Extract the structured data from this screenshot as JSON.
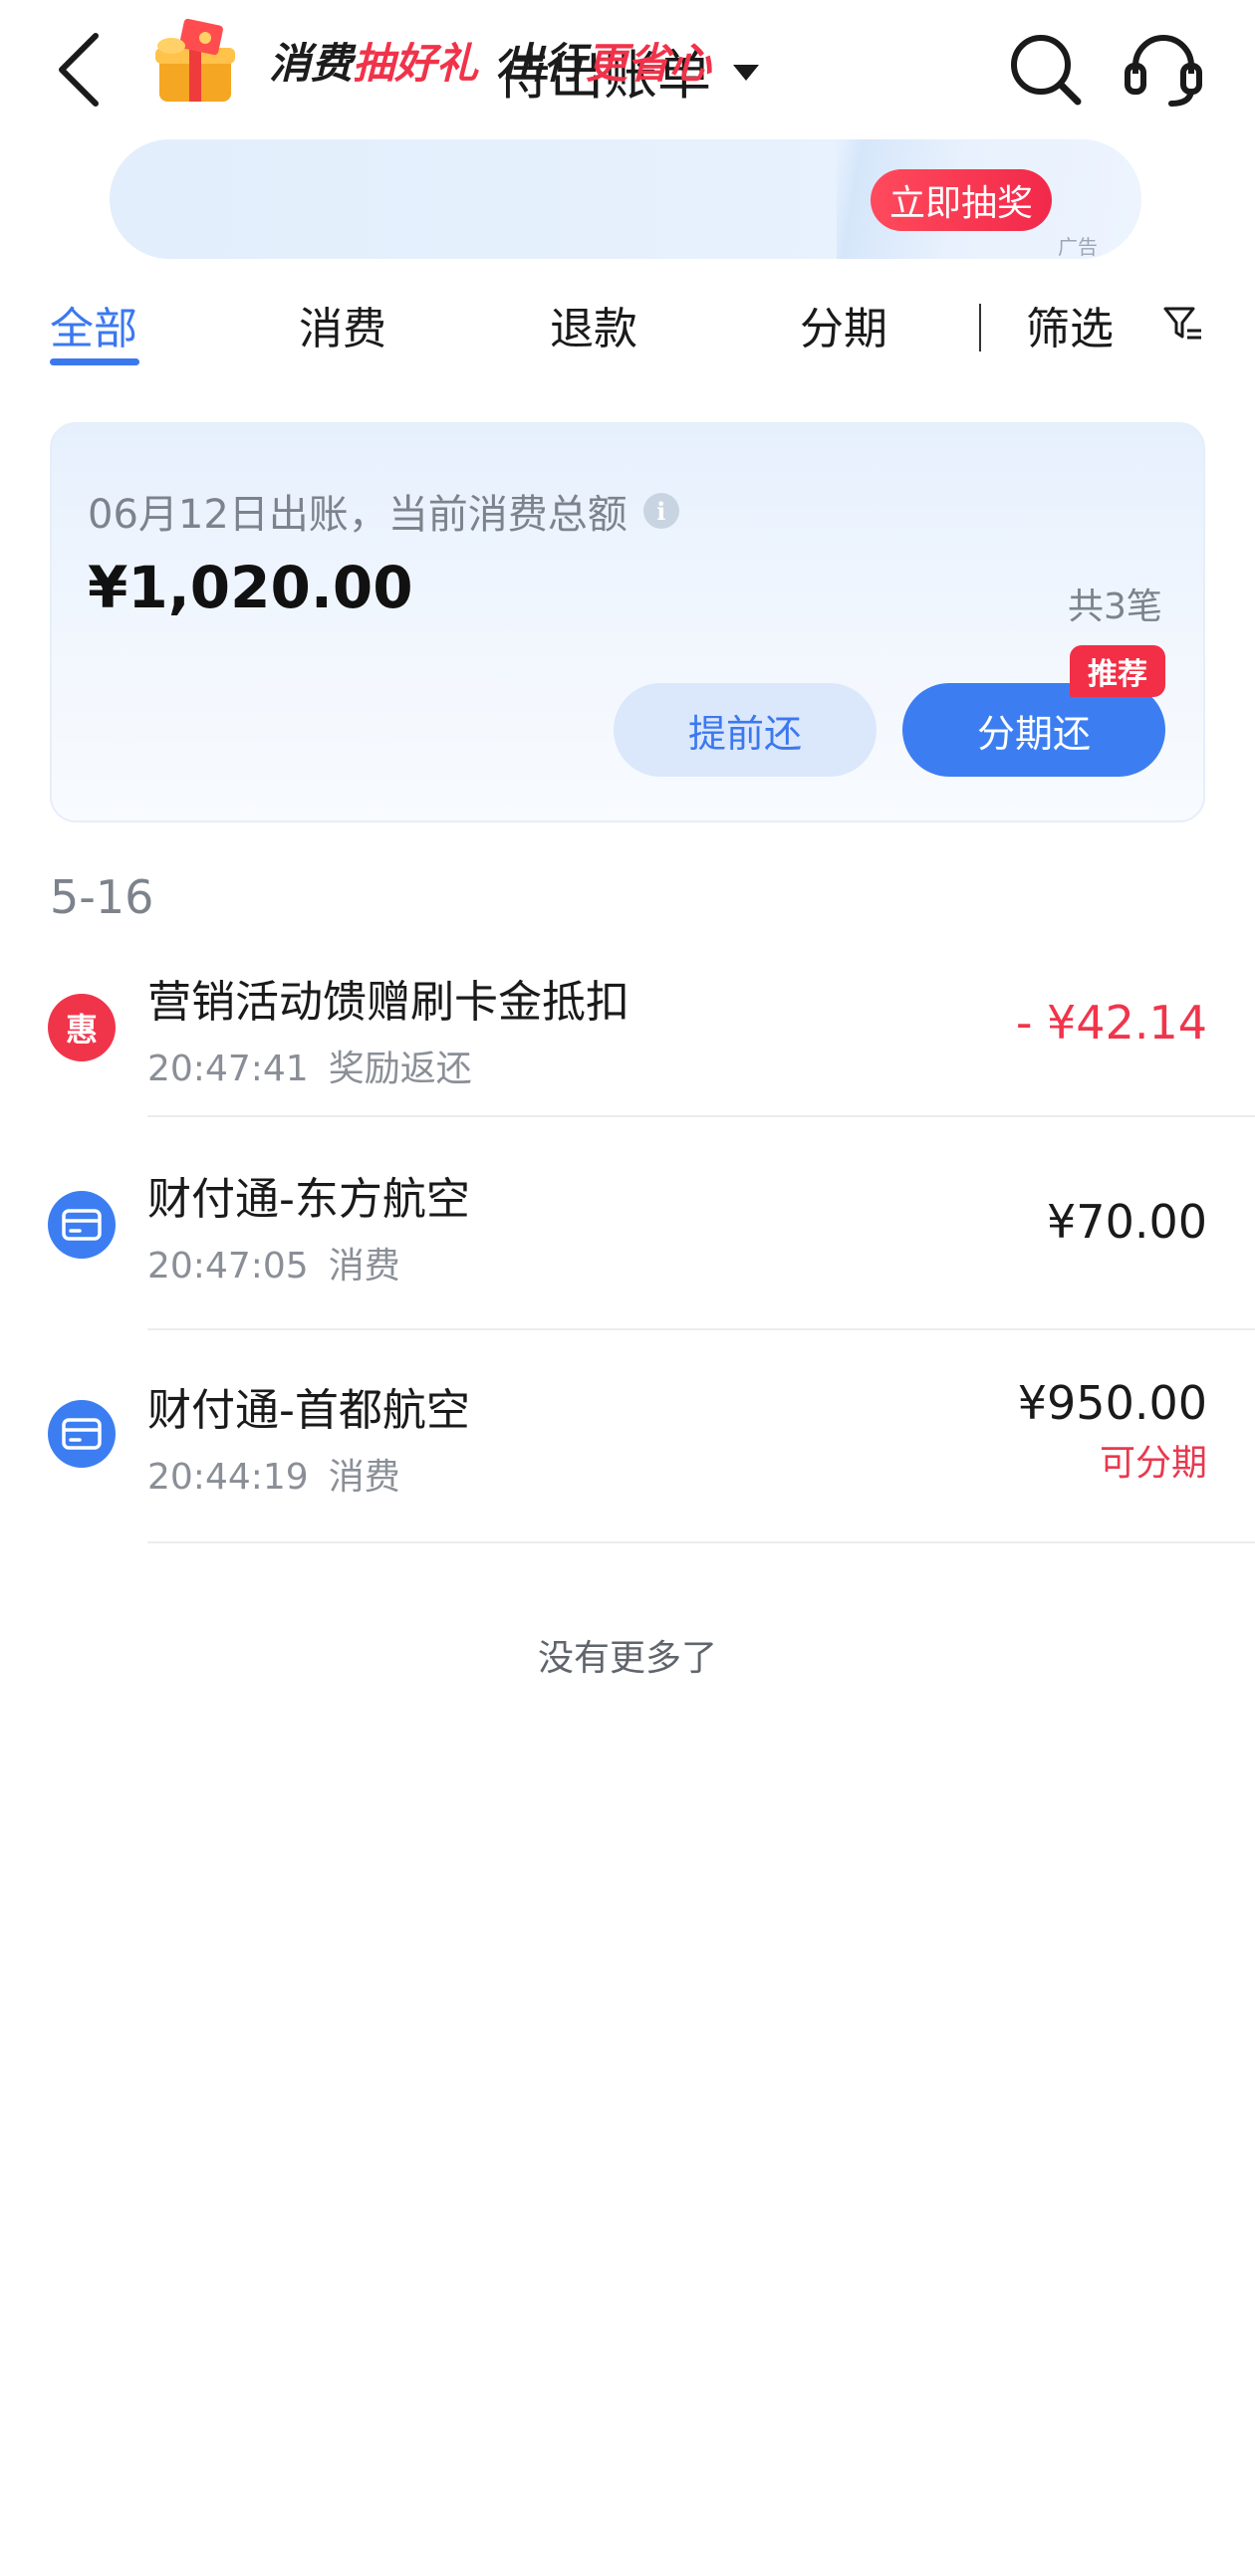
{
  "header": {
    "title": "待出账单",
    "icons": {
      "back": "back-arrow-icon",
      "dropdown": "caret-down-icon",
      "search": "search-icon",
      "service": "headset-icon"
    }
  },
  "banner": {
    "text_parts": [
      "消费",
      "抽好礼",
      "出行",
      "更省心"
    ],
    "button": "立即抽奖",
    "ad_label": "广告",
    "icon": "gift-box-icon"
  },
  "tabs": [
    {
      "label": "全部",
      "active": true
    },
    {
      "label": "消费",
      "active": false
    },
    {
      "label": "退款",
      "active": false
    },
    {
      "label": "分期",
      "active": false
    }
  ],
  "filter": {
    "label": "筛选",
    "icon": "filter-icon"
  },
  "summary": {
    "bill_date_text": "06月12日出账，当前消费总额",
    "info_icon": "i",
    "total": "¥1,020.00",
    "count": "共3笔",
    "prepay_button": "提前还",
    "installment_button": "分期还",
    "recommend_badge": "推荐"
  },
  "transactions": {
    "date_header": "5-16",
    "items": [
      {
        "icon_glyph": "惠",
        "title": "营销活动馈赠刷卡金抵扣",
        "time": "20:47:41",
        "type": "奖励返还",
        "amount": "- ¥42.14",
        "tag": ""
      },
      {
        "icon_glyph": "",
        "title": "财付通-东方航空",
        "time": "20:47:05",
        "type": "消费",
        "amount": "¥70.00",
        "tag": ""
      },
      {
        "icon_glyph": "",
        "title": "财付通-首都航空",
        "time": "20:44:19",
        "type": "消费",
        "amount": "¥950.00",
        "tag": "可分期"
      }
    ]
  },
  "footer": {
    "no_more": "没有更多了"
  },
  "colors": {
    "accent": "#3b78f0",
    "red": "#f0354b",
    "muted": "#7d838c"
  }
}
